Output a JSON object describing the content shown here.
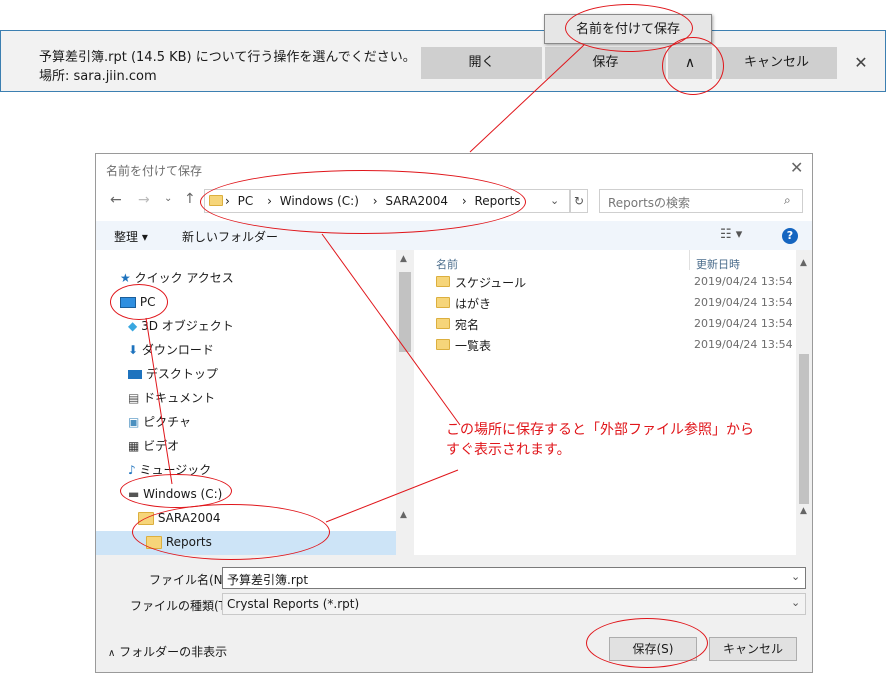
{
  "download_bar": {
    "line1": "予算差引簿.rpt (14.5 KB) について行う操作を選んでください。",
    "line2": "場所: sara.jiin.com",
    "open_label": "開く",
    "save_label": "保存",
    "cancel_label": "キャンセル",
    "expand_glyph": "∧",
    "close_glyph": "✕"
  },
  "save_menu": {
    "save_as_label": "名前を付けて保存"
  },
  "dialog": {
    "title": "名前を付けて保存",
    "close_glyph": "✕",
    "address": {
      "path": [
        "PC",
        "Windows (C:)",
        "SARA2004",
        "Reports"
      ],
      "separator": "›"
    },
    "search_placeholder": "Reportsの検索",
    "toolbar": {
      "organize": "整理 ▾",
      "new_folder": "新しいフォルダー"
    },
    "nav": {
      "quick_access": "クイック アクセス",
      "pc": "PC",
      "objects3d": "3D オブジェクト",
      "downloads": "ダウンロード",
      "desktop": "デスクトップ",
      "documents": "ドキュメント",
      "pictures": "ピクチャ",
      "videos": "ビデオ",
      "music": "ミュージック",
      "drive": "Windows (C:)",
      "sara": "SARA2004",
      "reports": "Reports"
    },
    "file_list": {
      "col_name": "名前",
      "col_modified": "更新日時",
      "items": [
        {
          "name": "スケジュール",
          "modified": "2019/04/24 13:54"
        },
        {
          "name": "はがき",
          "modified": "2019/04/24 13:54"
        },
        {
          "name": "宛名",
          "modified": "2019/04/24 13:54"
        },
        {
          "name": "一覧表",
          "modified": "2019/04/24 13:54"
        }
      ]
    },
    "filename_label": "ファイル名(N):",
    "filename_value": "予算差引簿.rpt",
    "filetype_label": "ファイルの種類(T):",
    "filetype_value": "Crystal Reports (*.rpt)",
    "hide_folders": "フォルダーの非表示",
    "save_button": "保存(S)",
    "cancel_button": "キャンセル"
  },
  "annotation": {
    "note_line1": "この場所に保存すると「外部ファイル参照」から",
    "note_line2": "すぐ表示されます。",
    "color": "#e0161b"
  }
}
